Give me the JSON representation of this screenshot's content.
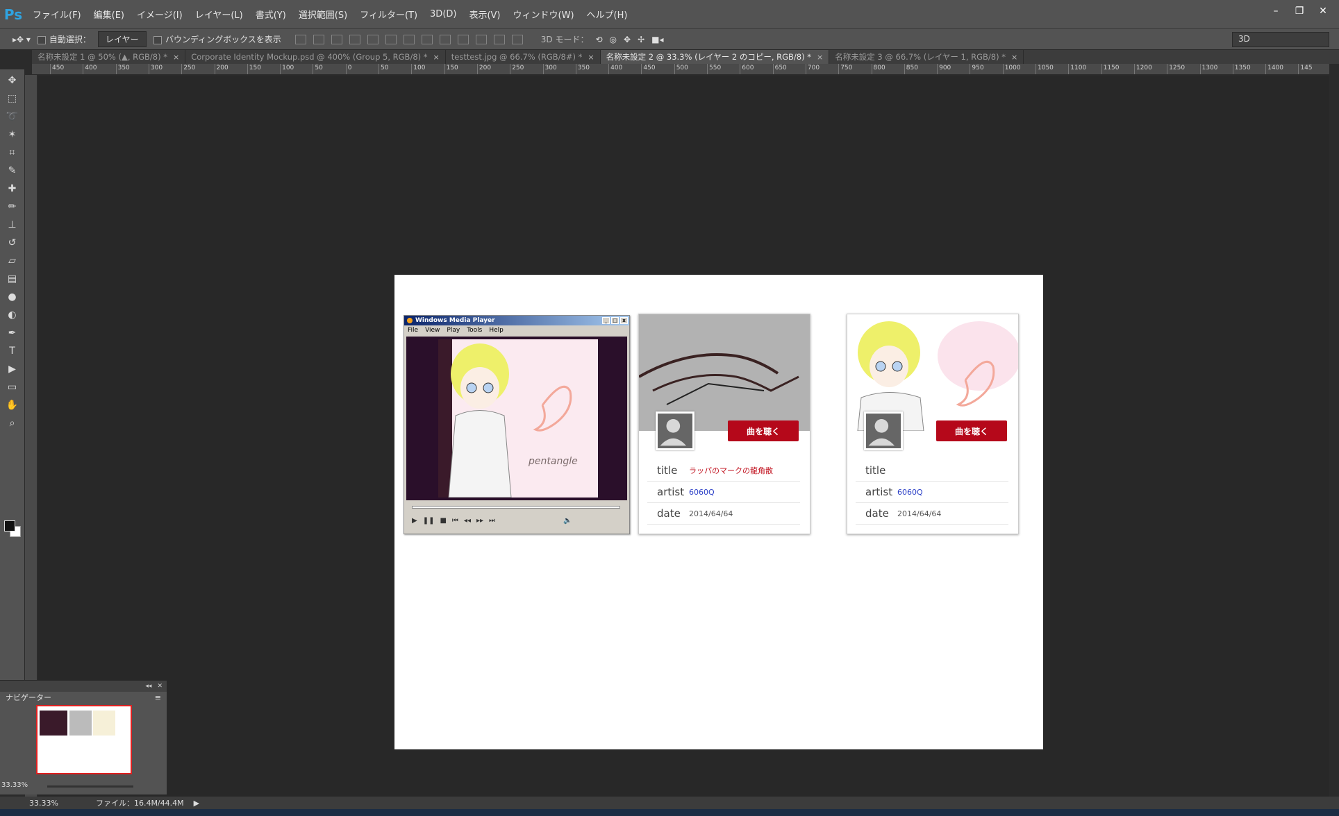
{
  "app": {
    "logo": "Ps"
  },
  "menu": [
    "ファイル(F)",
    "編集(E)",
    "イメージ(I)",
    "レイヤー(L)",
    "書式(Y)",
    "選択範囲(S)",
    "フィルター(T)",
    "3D(D)",
    "表示(V)",
    "ウィンドウ(W)",
    "ヘルプ(H)"
  ],
  "window_controls": {
    "minimize": "–",
    "restore": "❐",
    "close": "✕"
  },
  "options": {
    "auto_select_label": "自動選択：",
    "auto_select_value": "レイヤー",
    "bounding_box_label": "バウンディングボックスを表示",
    "mode3d_label": "3D モード：",
    "workspace_select": "3D"
  },
  "tabs": [
    {
      "label": "名称未設定 1 @ 50% (▲, RGB/8) *",
      "active": false
    },
    {
      "label": "Corporate Identity Mockup.psd @ 400% (Group 5, RGB/8) *",
      "active": false
    },
    {
      "label": "testtest.jpg @ 66.7% (RGB/8#) *",
      "active": false
    },
    {
      "label": "名称未設定 2 @ 33.3% (レイヤー 2 のコピー, RGB/8) *",
      "active": true
    },
    {
      "label": "名称未設定 3 @ 66.7% (レイヤー 1, RGB/8) *",
      "active": false
    }
  ],
  "ruler_top": [
    "450",
    "400",
    "350",
    "300",
    "250",
    "200",
    "150",
    "100",
    "50",
    "0",
    "50",
    "100",
    "150",
    "200",
    "250",
    "300",
    "350",
    "400",
    "450",
    "500",
    "550",
    "600",
    "650",
    "700",
    "750",
    "800",
    "850",
    "900",
    "950",
    "1000",
    "1050",
    "1100",
    "1150",
    "1200",
    "1250",
    "1300",
    "1350",
    "1400",
    "145"
  ],
  "wmp": {
    "title": "Windows Media Player",
    "menu": [
      "File",
      "View",
      "Play",
      "Tools",
      "Help"
    ],
    "art_caption": "pentangle"
  },
  "card1": {
    "listen_label": "曲を聴く",
    "title_key": "title",
    "title_val": "ラッパのマークの龍角散",
    "artist_key": "artist",
    "artist_val": "6060Q",
    "date_key": "date",
    "date_val": "2014/64/64"
  },
  "card2": {
    "listen_label": "曲を聴く",
    "title_key": "title",
    "title_val": "",
    "artist_key": "artist",
    "artist_val": "6060Q",
    "date_key": "date",
    "date_val": "2014/64/64"
  },
  "navigator": {
    "title": "ナビゲーター",
    "zoom": "33.33%"
  },
  "status": {
    "zoom": "33.33%",
    "file_info": "ファイル：16.4M/44.4M"
  }
}
